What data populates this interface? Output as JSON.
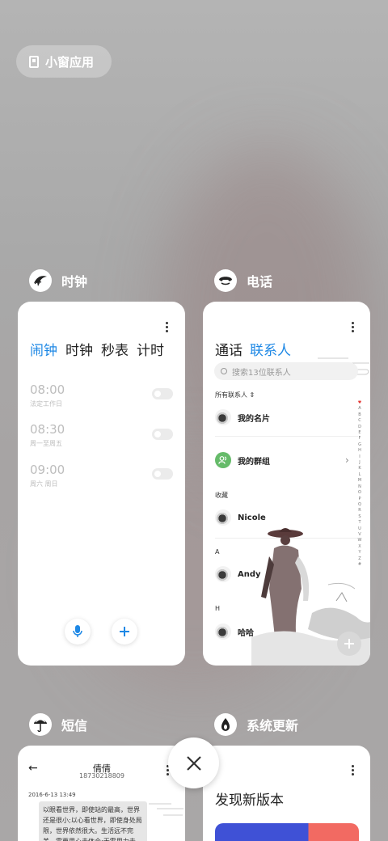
{
  "floating_button": {
    "label": "小窗应用",
    "icon": "small-window-icon"
  },
  "apps": {
    "clock": {
      "name": "时钟",
      "icon": "clock-app-icon",
      "tabs": [
        {
          "label": "闹钟",
          "active": true
        },
        {
          "label": "时钟",
          "active": false
        },
        {
          "label": "秒表",
          "active": false
        },
        {
          "label": "计时",
          "active": false
        }
      ],
      "alarms": [
        {
          "time": "08:00",
          "repeat": "法定工作日",
          "on": false
        },
        {
          "time": "08:30",
          "repeat": "周一至周五",
          "on": false
        },
        {
          "time": "09:00",
          "repeat": "周六 周日",
          "on": false
        }
      ],
      "accent": "#1e88e5"
    },
    "phone": {
      "name": "电话",
      "icon": "phone-app-icon",
      "tabs": [
        {
          "label": "通话",
          "active": false
        },
        {
          "label": "联系人",
          "active": true
        }
      ],
      "search_placeholder": "搜索13位联系人",
      "all_contacts_label": "所有联系人",
      "my_card": "我的名片",
      "my_groups": "我的群组",
      "favorites_label": "收藏",
      "contacts": [
        {
          "section": "",
          "name": "Nicole"
        },
        {
          "section": "A",
          "name": "Andy"
        },
        {
          "section": "H",
          "name": "哈哈"
        }
      ],
      "alphabet": [
        "♥",
        "A",
        "B",
        "C",
        "D",
        "E",
        "F",
        "G",
        "H",
        "I",
        "J",
        "K",
        "L",
        "M",
        "N",
        "O",
        "P",
        "Q",
        "R",
        "S",
        "T",
        "U",
        "V",
        "W",
        "X",
        "Y",
        "Z",
        "#"
      ]
    },
    "sms": {
      "name": "短信",
      "icon": "sms-app-icon",
      "contact_name": "倩倩",
      "contact_number": "18730218809",
      "date": "2016-6-13 13:49",
      "message": "以眼看世界，即使站的最高，世界还是很小;以心看世界，即使身处局限，世界依然很大。生活远不完美，需要用心去体会;无需用力去"
    },
    "update": {
      "name": "系统更新",
      "icon": "system-update-app-icon",
      "heading": "发现新版本",
      "banner_colors": [
        "#3f51d6",
        "#f26a62"
      ]
    }
  },
  "close_button": {
    "icon": "close-icon"
  }
}
